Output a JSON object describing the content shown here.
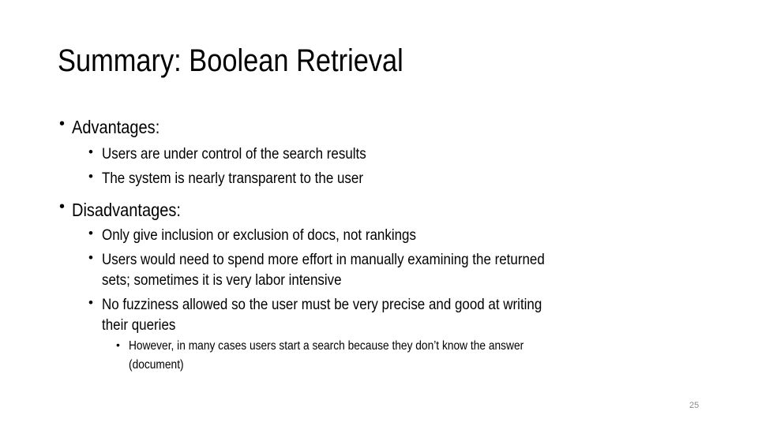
{
  "slide": {
    "title": "Summary: Boolean Retrieval",
    "bullet_glyph": "•",
    "sections": [
      {
        "heading": "Advantages:",
        "items": [
          {
            "lines": [
              "Users are under control of the search results"
            ]
          },
          {
            "lines": [
              "The system is nearly transparent to the user"
            ]
          }
        ]
      },
      {
        "heading": "Disadvantages:",
        "items": [
          {
            "lines": [
              "Only give inclusion or exclusion of docs, not rankings"
            ]
          },
          {
            "lines": [
              "Users  would need to spend more effort in manually examining the returned",
              "sets; sometimes it is very labor intensive"
            ]
          },
          {
            "lines": [
              "No fuzziness allowed so the user must be very precise and good at writing",
              "their queries"
            ],
            "subitems": [
              {
                "lines": [
                  "However, in many cases users start a search because they don’t know the answer",
                  "(document)"
                ]
              }
            ]
          }
        ]
      }
    ],
    "page_number": "25"
  }
}
